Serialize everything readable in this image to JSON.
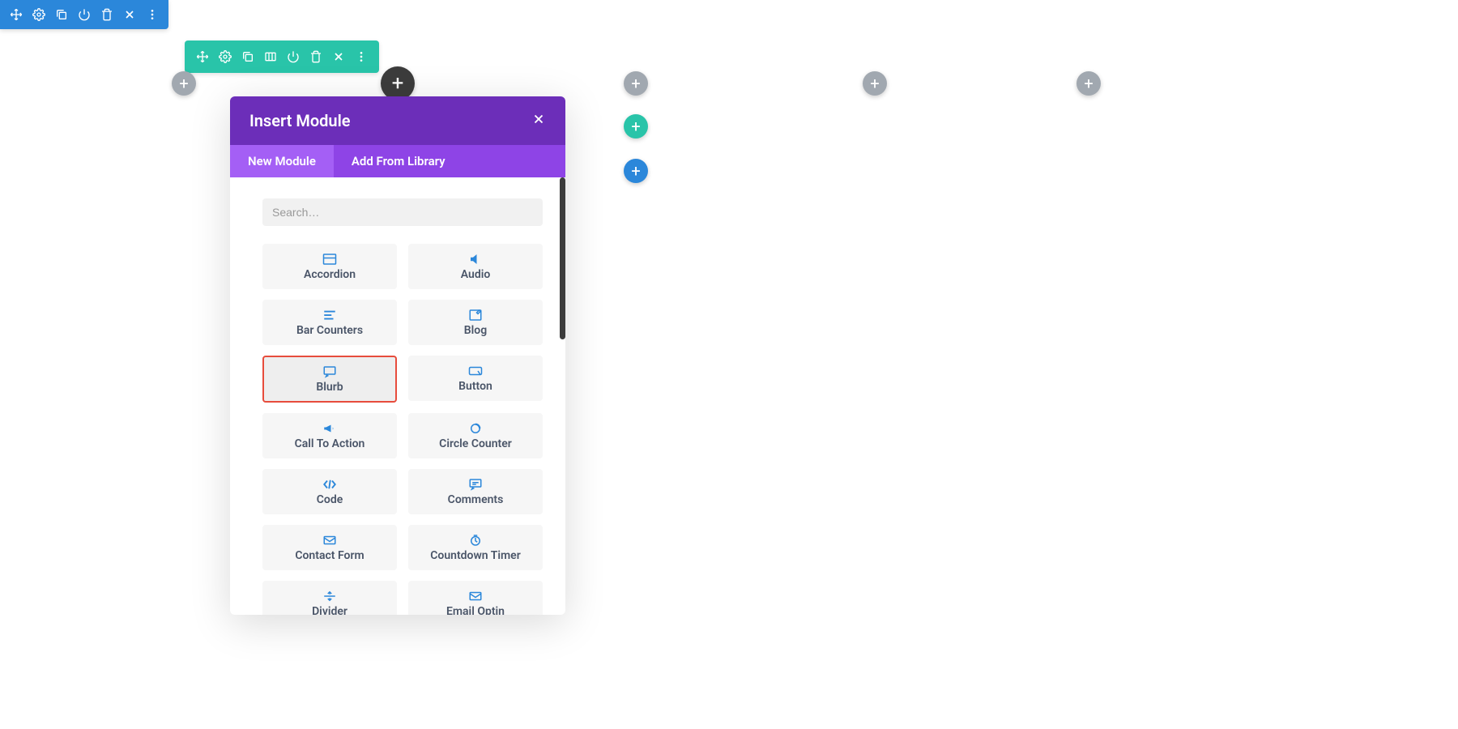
{
  "modal": {
    "title": "Insert Module",
    "tabs": {
      "new": "New Module",
      "library": "Add From Library"
    },
    "search_placeholder": "Search…"
  },
  "modules": {
    "accordion": "Accordion",
    "audio": "Audio",
    "bar_counters": "Bar Counters",
    "blog": "Blog",
    "blurb": "Blurb",
    "button": "Button",
    "call_to_action": "Call To Action",
    "circle_counter": "Circle Counter",
    "code": "Code",
    "comments": "Comments",
    "contact_form": "Contact Form",
    "countdown_timer": "Countdown Timer",
    "divider": "Divider",
    "email_optin": "Email Optin"
  },
  "icons": {
    "plus": "+"
  },
  "colors": {
    "section_toolbar": "#2B87DA",
    "row_toolbar": "#29C4A9",
    "modal_header": "#6C2EB9",
    "tab_bg": "#8E44E6",
    "tab_active": "#A45FF5",
    "highlight": "#E74C3C",
    "icon_blue": "#2B87DA"
  }
}
